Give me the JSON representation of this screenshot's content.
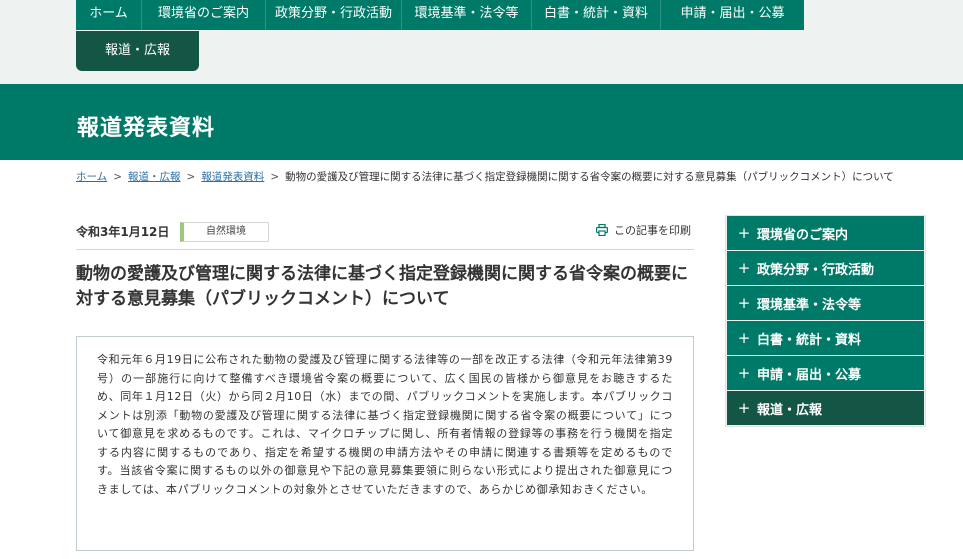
{
  "global_nav": {
    "items": [
      {
        "label": "ホーム",
        "width": 66
      },
      {
        "label": "環境省のご案内",
        "width": 124
      },
      {
        "label": "政策分野・行政活動",
        "width": 136
      },
      {
        "label": "環境基準・法令等",
        "width": 130
      },
      {
        "label": "白書・統計・資料",
        "width": 129
      },
      {
        "label": "申請・届出・公募",
        "width": 143
      }
    ],
    "active": "報道・広報"
  },
  "hero": {
    "title": "報道発表資料"
  },
  "breadcrumb": {
    "items": [
      "ホーム",
      "報道・広報",
      "報道発表資料"
    ],
    "separator": ">",
    "current": "動物の愛護及び管理に関する法律に基づく指定登録機関に関する省令案の概要に対する意見募集（パブリックコメント）について"
  },
  "article": {
    "date": "令和3年1月12日",
    "tag": "自然環境",
    "print_label": "この記事を印刷",
    "title": "動物の愛護及び管理に関する法律に基づく指定登録機関に関する省令案の概要に対する意見募集（パブリックコメント）について",
    "body": "令和元年６月19日に公布された動物の愛護及び管理に関する法律等の一部を改正する法律（令和元年法律第39号）の一部施行に向けて整備すべき環境省令案の概要について、広く国民の皆様から御意見をお聴きするため、同年１月12日（火）から同２月10日（水）までの間、パブリックコメントを実施します。本パブリックコメントは別添「動物の愛護及び管理に関する法律に基づく指定登録機関に関する省令案の概要について」について御意見を求めるものです。これは、マイクロチップに関し、所有者情報の登録等の事務を行う機関を指定する内容に関するものであり、指定を希望する機関の申請方法やその申請に関連する書類等を定めるものです。当該省令案に関するもの以外の御意見や下記の意見募集要領に則らない形式により提出された御意見につきましては、本パブリックコメントの対象外とさせていただきますので、あらかじめ御承知おきください。"
  },
  "sidebar": {
    "icon": "plus-icon",
    "items": [
      "環境省のご案内",
      "政策分野・行政活動",
      "環境基準・法令等",
      "白書・統計・資料",
      "申請・届出・公募",
      "報道・広報"
    ],
    "active_index": 5
  },
  "colors": {
    "primary": "#007a68",
    "dark": "#145646",
    "tag_accent": "#9cc97c",
    "link": "#2a6fa8"
  }
}
